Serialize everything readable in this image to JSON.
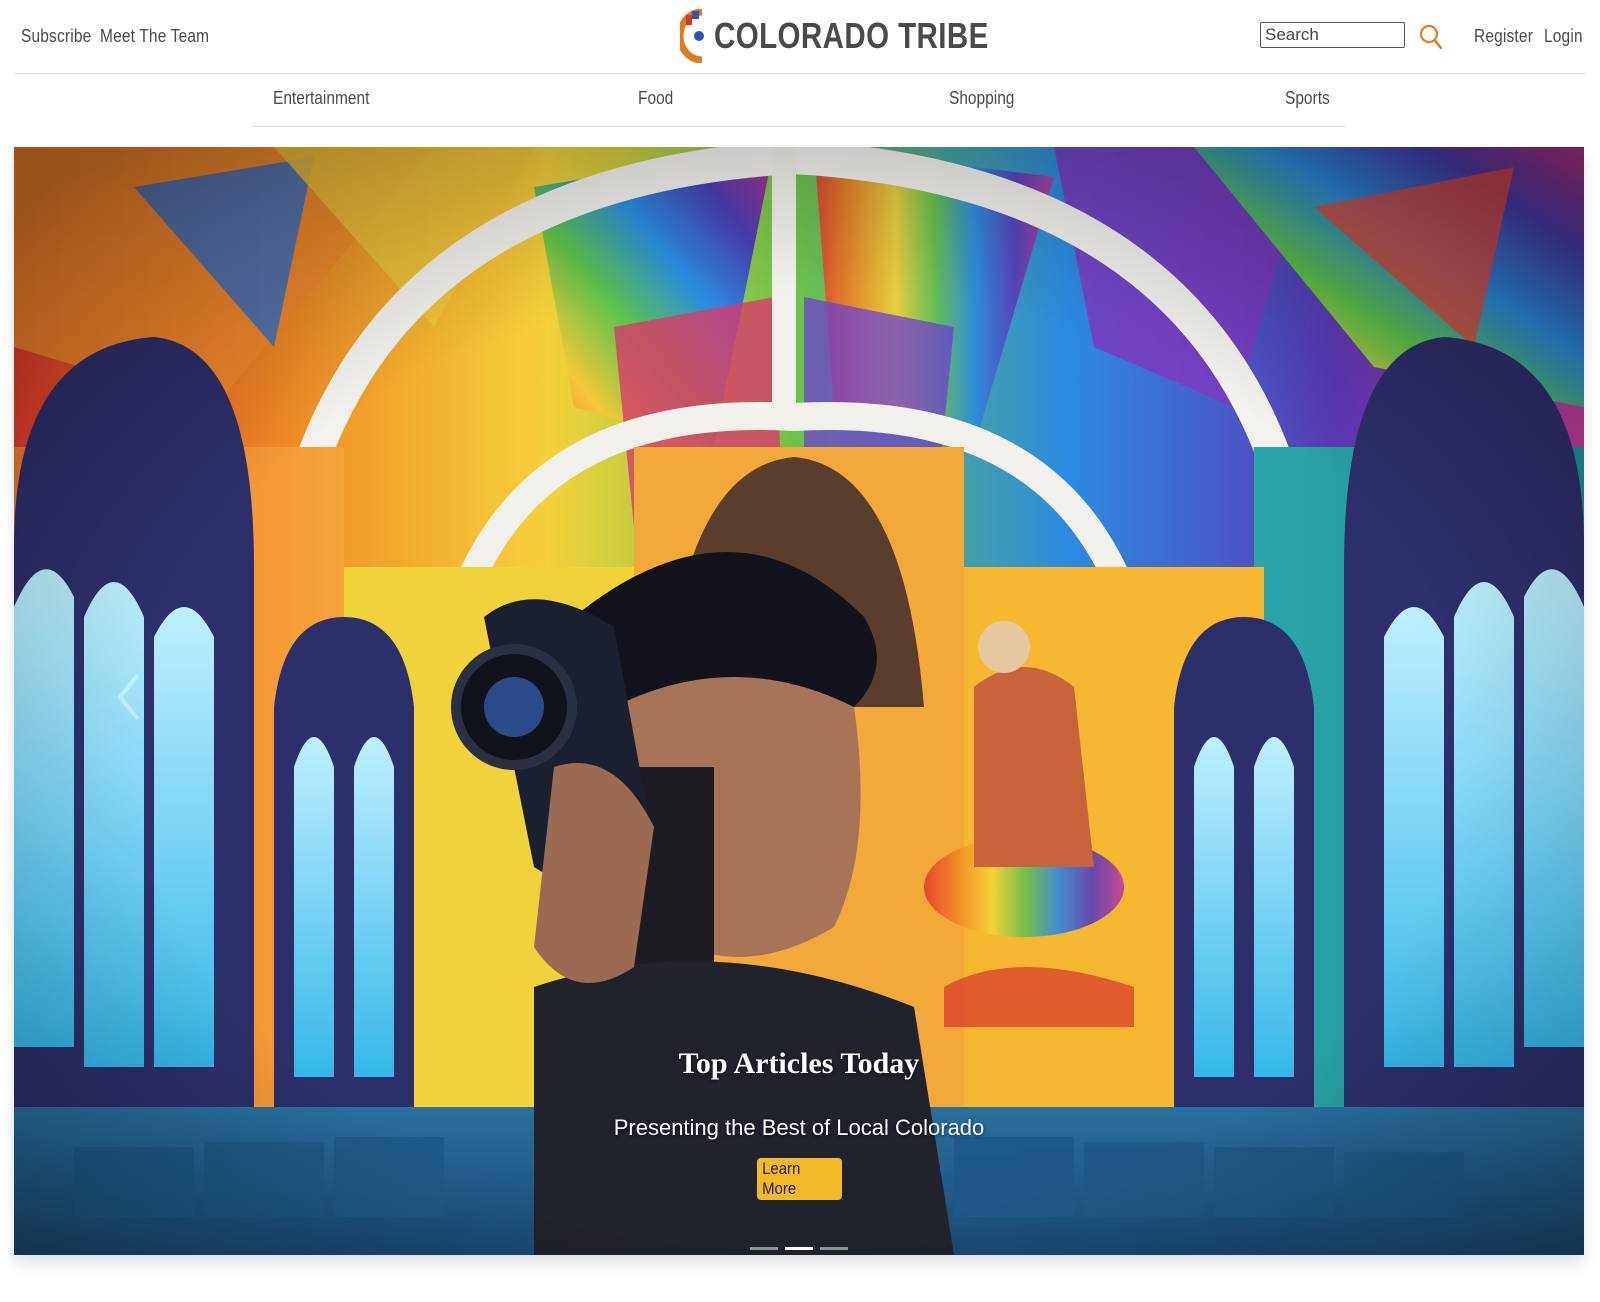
{
  "header": {
    "left_links": [
      {
        "label": "Subscribe"
      },
      {
        "label": "Meet The Team"
      }
    ],
    "logo_text": "COLORADO TRIBE",
    "logo_colors": {
      "blue": "#2b55b8",
      "orange": "#e07a1c",
      "red": "#d9342b"
    },
    "search": {
      "placeholder": "Search",
      "value": "",
      "icon": "search-icon",
      "icon_color": "#e07a1c"
    },
    "right_links": [
      {
        "label": "Register"
      },
      {
        "label": "Login"
      }
    ]
  },
  "nav": {
    "items": [
      {
        "label": "Entertainment"
      },
      {
        "label": "Food"
      },
      {
        "label": "Shopping"
      },
      {
        "label": "Sports"
      }
    ]
  },
  "hero": {
    "caption_title": "Top Articles Today",
    "caption_subtitle": "Presenting the Best of Local Colorado",
    "cta_label": "Learn More",
    "cta_color": "#f4b927",
    "slides_total": 3,
    "active_slide": 2,
    "prev_icon": "chevron-left-icon"
  }
}
